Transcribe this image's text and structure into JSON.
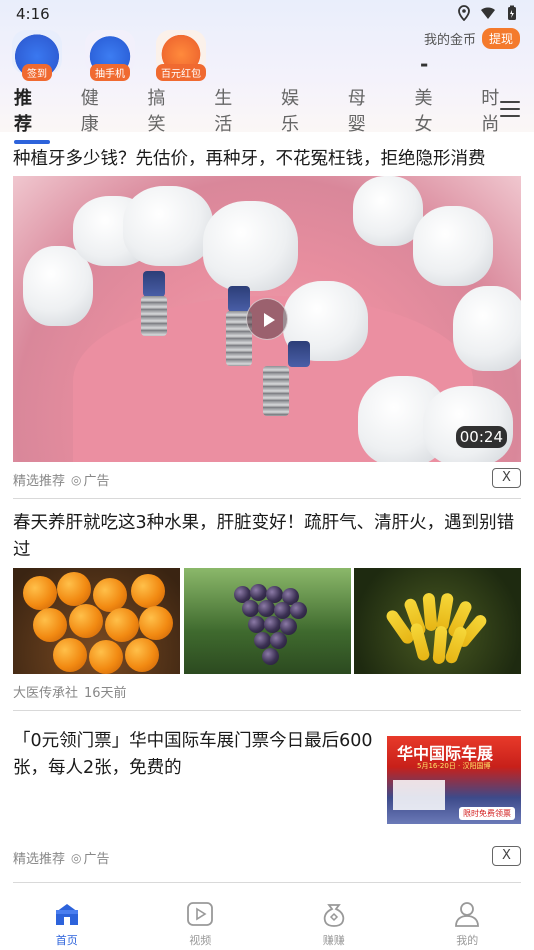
{
  "status_bar": {
    "time": "4:16"
  },
  "quick_actions": [
    {
      "label": "签到",
      "icon": "calendar-check-icon"
    },
    {
      "label": "抽手机",
      "icon": "phone-gift-icon"
    },
    {
      "label": "百元红包",
      "icon": "red-envelope-icon"
    }
  ],
  "wallet": {
    "gold_label": "我的金币",
    "withdraw_label": "提现",
    "gold_value": "-"
  },
  "tabs": [
    "推荐",
    "健康",
    "搞笑",
    "生活",
    "娱乐",
    "母婴",
    "美女",
    "时尚"
  ],
  "feed": [
    {
      "title": "种植牙多少钱？先估价，再种牙，不花冤枉钱，拒绝隐形消费",
      "duration": "00:24",
      "source": "精选推荐",
      "ad_label": "广告",
      "close": "X"
    },
    {
      "title": "春天养肝就吃这3种水果，肝脏变好！疏肝气、清肝火，遇到别错过",
      "source": "大医传承社",
      "time": "16天前"
    },
    {
      "title": "「0元领门票」华中国际车展门票今日最后600张，每人2张，免费的",
      "source": "精选推荐",
      "ad_label": "广告",
      "close": "X",
      "banner": {
        "title": "华中国际车展",
        "date": "5月16-20日 · 汉阳国博",
        "button": "限时免费领票"
      }
    }
  ],
  "bottom_nav": [
    {
      "label": "首页",
      "icon": "home-icon",
      "active": true
    },
    {
      "label": "视频",
      "icon": "video-play-icon"
    },
    {
      "label": "赚赚",
      "icon": "coin-bag-icon"
    },
    {
      "label": "我的",
      "icon": "profile-icon"
    }
  ],
  "colors": {
    "accent": "#2d63db",
    "orange": "#f47a2c"
  }
}
